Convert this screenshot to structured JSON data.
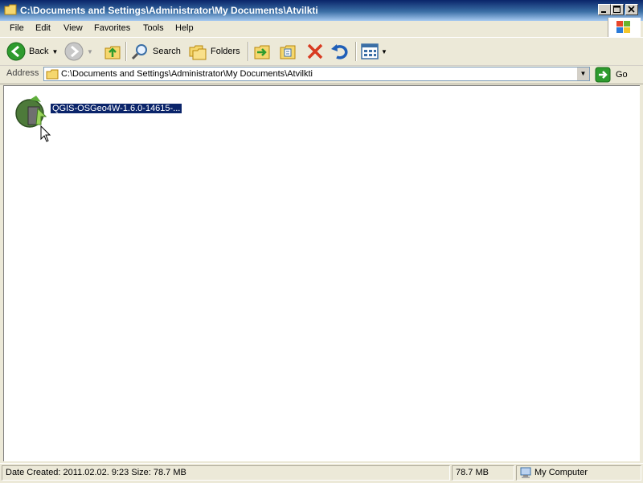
{
  "window": {
    "title": "C:\\Documents and Settings\\Administrator\\My Documents\\Atvilkti"
  },
  "title_buttons": [
    "minimize",
    "maximize",
    "close"
  ],
  "menu": [
    "File",
    "Edit",
    "View",
    "Favorites",
    "Tools",
    "Help"
  ],
  "toolbar": {
    "back_label": "Back",
    "search_label": "Search",
    "folders_label": "Folders"
  },
  "address": {
    "label": "Address",
    "value": "C:\\Documents and Settings\\Administrator\\My Documents\\Atvilkti",
    "go_label": "Go"
  },
  "files": [
    {
      "name": "QGIS-OSGeo4W-1.6.0-14615-...",
      "icon": "qgis-installer-icon",
      "selected": true
    }
  ],
  "status": {
    "details": "Date Created: 2011.02.02. 9:23 Size: 78.7 MB",
    "size": "78.7 MB",
    "zone": "My Computer"
  },
  "colors": {
    "title_bar": "#0a246a",
    "selection": "#0a246a",
    "back_green": "#2e9b2e",
    "delete_red": "#d83a20"
  }
}
